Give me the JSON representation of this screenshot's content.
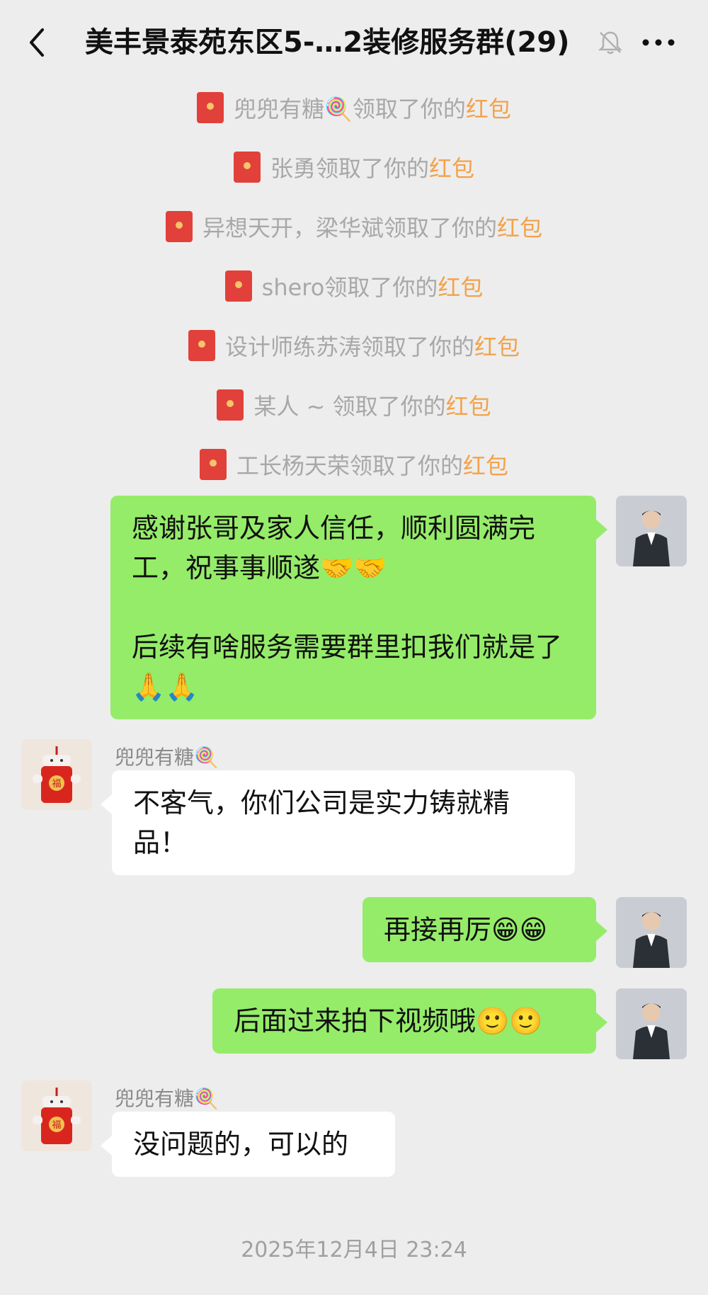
{
  "header": {
    "title": "美丰景泰苑东区5-…2装修服务群(29)",
    "back_icon": "chevron-left-icon",
    "mute_icon": "bell-muted-icon",
    "more_icon": "more-dots-icon"
  },
  "system_messages": [
    {
      "text": "兜兜有糖🍭领取了你的",
      "link": "红包"
    },
    {
      "text": "张勇领取了你的",
      "link": "红包"
    },
    {
      "text": "异想天开，梁华斌领取了你的",
      "link": "红包"
    },
    {
      "text": "shero领取了你的",
      "link": "红包"
    },
    {
      "text": "设计师练苏涛领取了你的",
      "link": "红包"
    },
    {
      "text": "某人 ~ 领取了你的",
      "link": "红包"
    },
    {
      "text": "工长杨天荣领取了你的",
      "link": "红包"
    }
  ],
  "messages": [
    {
      "side": "me",
      "paragraphs": [
        "感谢张哥及家人信任，顺利圆满完工，祝事事顺遂🤝🤝",
        "后续有啥服务需要群里扣我们就是了🙏🙏"
      ]
    },
    {
      "side": "other",
      "sender": "兜兜有糖🍭",
      "text": "不客气，你们公司是实力铸就精品！"
    },
    {
      "side": "me",
      "text": "再接再厉😁😁"
    },
    {
      "side": "me",
      "text": "后面过来拍下视频哦🙂🙂"
    },
    {
      "side": "other",
      "sender": "兜兜有糖🍭",
      "text": "没问题的，可以的"
    }
  ],
  "timestamp": "2025年12月4日 23:24",
  "colors": {
    "background": "#ededed",
    "my_bubble": "#95ec69",
    "other_bubble": "#ffffff",
    "red_packet_link": "#f3a24a",
    "system_text": "#a8a8a8"
  }
}
